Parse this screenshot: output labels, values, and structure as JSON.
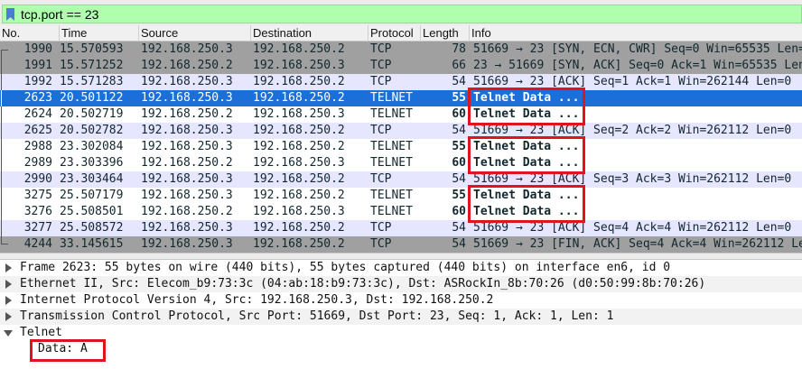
{
  "filter": {
    "text": "tcp.port == 23"
  },
  "columns": [
    "No.",
    "Time",
    "Source",
    "Destination",
    "Protocol",
    "Length",
    "Info"
  ],
  "packets": [
    {
      "no": "1990",
      "time": "15.570593",
      "src": "192.168.250.3",
      "dst": "192.168.250.2",
      "proto": "TCP",
      "len": "78",
      "info": "51669 → 23 [SYN, ECN, CWR] Seq=0 Win=65535 Len=0"
    },
    {
      "no": "1991",
      "time": "15.571252",
      "src": "192.168.250.2",
      "dst": "192.168.250.3",
      "proto": "TCP",
      "len": "66",
      "info": "23 → 51669 [SYN, ACK] Seq=0 Ack=1 Win=65535 Len=0"
    },
    {
      "no": "1992",
      "time": "15.571283",
      "src": "192.168.250.3",
      "dst": "192.168.250.2",
      "proto": "TCP",
      "len": "54",
      "info": "51669 → 23 [ACK] Seq=1 Ack=1 Win=262144 Len=0"
    },
    {
      "no": "2623",
      "time": "20.501122",
      "src": "192.168.250.3",
      "dst": "192.168.250.2",
      "proto": "TELNET",
      "len": "55",
      "info": "Telnet Data ..."
    },
    {
      "no": "2624",
      "time": "20.502719",
      "src": "192.168.250.2",
      "dst": "192.168.250.3",
      "proto": "TELNET",
      "len": "60",
      "info": "Telnet Data ..."
    },
    {
      "no": "2625",
      "time": "20.502782",
      "src": "192.168.250.3",
      "dst": "192.168.250.2",
      "proto": "TCP",
      "len": "54",
      "info": "51669 → 23 [ACK] Seq=2 Ack=2 Win=262112 Len=0"
    },
    {
      "no": "2988",
      "time": "23.302084",
      "src": "192.168.250.3",
      "dst": "192.168.250.2",
      "proto": "TELNET",
      "len": "55",
      "info": "Telnet Data ..."
    },
    {
      "no": "2989",
      "time": "23.303396",
      "src": "192.168.250.2",
      "dst": "192.168.250.3",
      "proto": "TELNET",
      "len": "60",
      "info": "Telnet Data ..."
    },
    {
      "no": "2990",
      "time": "23.303464",
      "src": "192.168.250.3",
      "dst": "192.168.250.2",
      "proto": "TCP",
      "len": "54",
      "info": "51669 → 23 [ACK] Seq=3 Ack=3 Win=262112 Len=0"
    },
    {
      "no": "3275",
      "time": "25.507179",
      "src": "192.168.250.3",
      "dst": "192.168.250.2",
      "proto": "TELNET",
      "len": "55",
      "info": "Telnet Data ..."
    },
    {
      "no": "3276",
      "time": "25.508501",
      "src": "192.168.250.2",
      "dst": "192.168.250.3",
      "proto": "TELNET",
      "len": "60",
      "info": "Telnet Data ..."
    },
    {
      "no": "3277",
      "time": "25.508572",
      "src": "192.168.250.3",
      "dst": "192.168.250.2",
      "proto": "TCP",
      "len": "54",
      "info": "51669 → 23 [ACK] Seq=4 Ack=4 Win=262112 Len=0"
    },
    {
      "no": "4244",
      "time": "33.145615",
      "src": "192.168.250.3",
      "dst": "192.168.250.2",
      "proto": "TCP",
      "len": "54",
      "info": "51669 → 23 [FIN, ACK] Seq=4 Ack=4 Win=262112 Len=0"
    }
  ],
  "details": [
    {
      "text": "Frame 2623: 55 bytes on wire (440 bits), 55 bytes captured (440 bits) on interface en6, id 0",
      "expanded": false
    },
    {
      "text": "Ethernet II, Src: Elecom_b9:73:3c (04:ab:18:b9:73:3c), Dst: ASRockIn_8b:70:26 (d0:50:99:8b:70:26)",
      "expanded": false
    },
    {
      "text": "Internet Protocol Version 4, Src: 192.168.250.3, Dst: 192.168.250.2",
      "expanded": false
    },
    {
      "text": "Transmission Control Protocol, Src Port: 51669, Dst Port: 23, Seq: 1, Ack: 1, Len: 1",
      "expanded": false
    },
    {
      "text": "Telnet",
      "expanded": true
    },
    {
      "text": "Data: A",
      "expanded": null
    }
  ],
  "colors": {
    "selected": "#1a70d8",
    "tcp_row": "#e7e6ff",
    "dark_row": "#a0a0a0",
    "highlight": "#e0141e",
    "filter_ok": "#afffaf"
  }
}
